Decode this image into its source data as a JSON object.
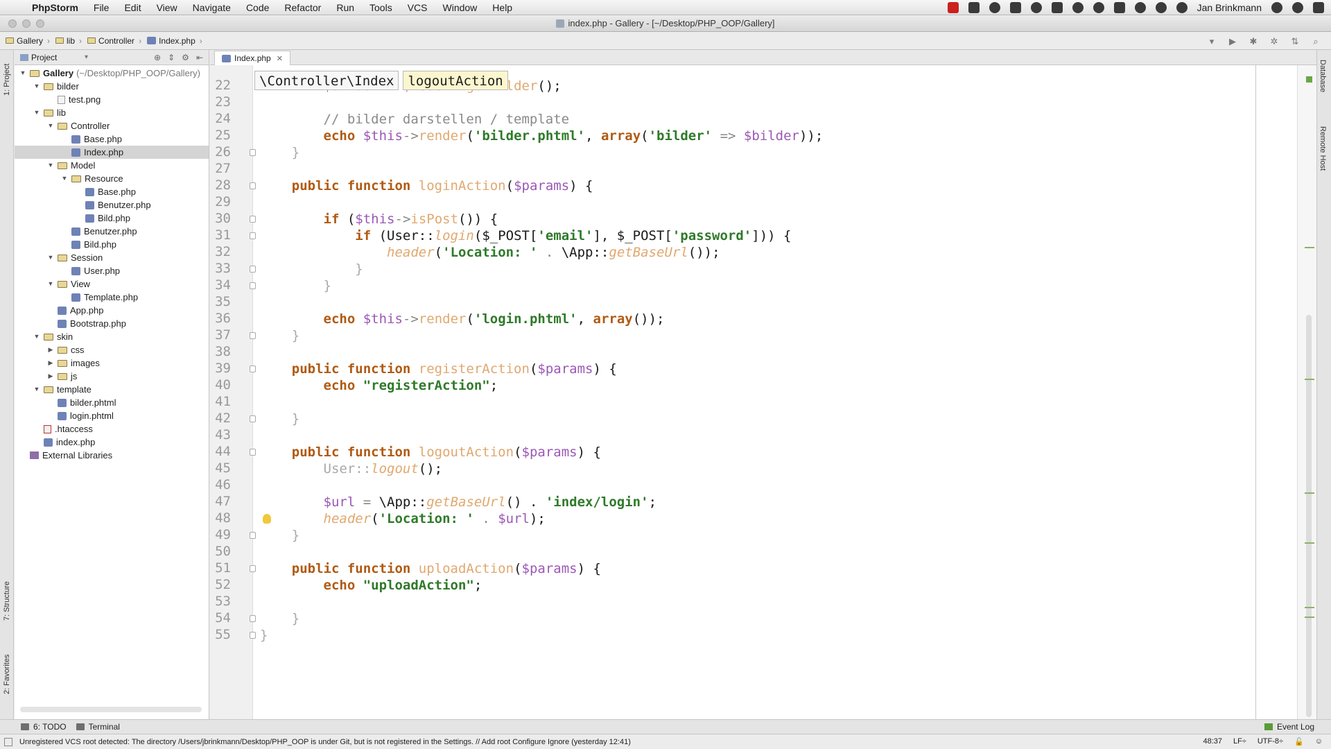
{
  "menubar": {
    "app_name": "PhpStorm",
    "items": [
      "File",
      "Edit",
      "View",
      "Navigate",
      "Code",
      "Refactor",
      "Run",
      "Tools",
      "VCS",
      "Window",
      "Help"
    ],
    "user": "Jan Brinkmann"
  },
  "window": {
    "title": "index.php - Gallery - [~/Desktop/PHP_OOP/Gallery]"
  },
  "navbar": {
    "crumbs": [
      "Gallery",
      "lib",
      "Controller",
      "Index.php"
    ]
  },
  "left_stripe": {
    "project_tab": "1: Project",
    "structure_tab": "7: Structure",
    "favorites_tab": "2: Favorites"
  },
  "project_panel": {
    "selector": "Project",
    "tree": [
      {
        "name": "Gallery",
        "path": "(~/Desktop/PHP_OOP/Gallery)",
        "type": "folder",
        "level": 0,
        "open": true
      },
      {
        "name": "bilder",
        "type": "folder",
        "level": 1,
        "open": true
      },
      {
        "name": "test.png",
        "type": "png",
        "level": 2
      },
      {
        "name": "lib",
        "type": "folder",
        "level": 1,
        "open": true
      },
      {
        "name": "Controller",
        "type": "folder",
        "level": 2,
        "open": true
      },
      {
        "name": "Base.php",
        "type": "php",
        "level": 3
      },
      {
        "name": "Index.php",
        "type": "php",
        "level": 3,
        "selected": true
      },
      {
        "name": "Model",
        "type": "folder",
        "level": 2,
        "open": true
      },
      {
        "name": "Resource",
        "type": "folder",
        "level": 3,
        "open": true
      },
      {
        "name": "Base.php",
        "type": "php",
        "level": 4
      },
      {
        "name": "Benutzer.php",
        "type": "php",
        "level": 4
      },
      {
        "name": "Bild.php",
        "type": "php",
        "level": 4
      },
      {
        "name": "Benutzer.php",
        "type": "php",
        "level": 3
      },
      {
        "name": "Bild.php",
        "type": "php",
        "level": 3
      },
      {
        "name": "Session",
        "type": "folder",
        "level": 2,
        "open": true
      },
      {
        "name": "User.php",
        "type": "php",
        "level": 3
      },
      {
        "name": "View",
        "type": "folder",
        "level": 2,
        "open": true
      },
      {
        "name": "Template.php",
        "type": "php",
        "level": 3
      },
      {
        "name": "App.php",
        "type": "php",
        "level": 2
      },
      {
        "name": "Bootstrap.php",
        "type": "php",
        "level": 2
      },
      {
        "name": "skin",
        "type": "folder",
        "level": 1,
        "open": true
      },
      {
        "name": "css",
        "type": "folder",
        "level": 2,
        "open": false
      },
      {
        "name": "images",
        "type": "folder",
        "level": 2,
        "open": false
      },
      {
        "name": "js",
        "type": "folder",
        "level": 2,
        "open": false
      },
      {
        "name": "template",
        "type": "folder",
        "level": 1,
        "open": true
      },
      {
        "name": "bilder.phtml",
        "type": "phtml",
        "level": 2
      },
      {
        "name": "login.phtml",
        "type": "phtml",
        "level": 2
      },
      {
        "name": ".htaccess",
        "type": "ht",
        "level": 1
      },
      {
        "name": "index.php",
        "type": "php",
        "level": 1
      },
      {
        "name": "External Libraries",
        "type": "lib",
        "level": 0
      }
    ]
  },
  "editor": {
    "tab_label": "Index.php",
    "breadcrumb": [
      "\\Controller\\Index",
      "logoutAction"
    ],
    "lines": [
      {
        "n": 22,
        "segs": [
          [
            "var",
            "        $bilder"
          ],
          [
            "op",
            " = "
          ],
          [
            "var",
            "$model"
          ],
          [
            "op",
            "->"
          ],
          [
            "fn",
            "getBilder"
          ],
          [
            "",
            "();"
          ]
        ]
      },
      {
        "n": 23,
        "segs": []
      },
      {
        "n": 24,
        "segs": [
          [
            "cmt",
            "        // bilder darstellen / template"
          ]
        ]
      },
      {
        "n": 25,
        "segs": [
          [
            "kw",
            "        echo "
          ],
          [
            "var",
            "$this"
          ],
          [
            "op",
            "->"
          ],
          [
            "fn",
            "render"
          ],
          [
            "",
            "("
          ],
          [
            "str",
            "'bilder.phtml'"
          ],
          [
            "",
            ", "
          ],
          [
            "kw",
            "array"
          ],
          [
            "",
            "("
          ],
          [
            "str",
            "'bilder'"
          ],
          [
            "op",
            " => "
          ],
          [
            "var",
            "$bilder"
          ],
          [
            "",
            "));"
          ]
        ]
      },
      {
        "n": 26,
        "segs": [
          [
            "dim",
            "    }"
          ]
        ]
      },
      {
        "n": 27,
        "segs": []
      },
      {
        "n": 28,
        "segs": [
          [
            "kw",
            "    public function "
          ],
          [
            "fn",
            "loginAction"
          ],
          [
            "",
            "("
          ],
          [
            "var",
            "$params"
          ],
          [
            "",
            ") {"
          ]
        ]
      },
      {
        "n": 29,
        "segs": []
      },
      {
        "n": 30,
        "segs": [
          [
            "kw",
            "        if "
          ],
          [
            "",
            "("
          ],
          [
            "var",
            "$this"
          ],
          [
            "op",
            "->"
          ],
          [
            "fn",
            "isPost"
          ],
          [
            "",
            "()) {"
          ]
        ]
      },
      {
        "n": 31,
        "segs": [
          [
            "kw",
            "            if "
          ],
          [
            "",
            "(User::"
          ],
          [
            "fn2",
            "login"
          ],
          [
            "",
            "($_POST["
          ],
          [
            "str",
            "'email'"
          ],
          [
            "",
            "], $_POST["
          ],
          [
            "str",
            "'password'"
          ],
          [
            "",
            "])) {"
          ]
        ]
      },
      {
        "n": 32,
        "segs": [
          [
            "fn2",
            "                header"
          ],
          [
            "",
            "("
          ],
          [
            "str",
            "'Location: '"
          ],
          [
            "op",
            " . "
          ],
          [
            "",
            "\\App::"
          ],
          [
            "fn2",
            "getBaseUrl"
          ],
          [
            "",
            "());"
          ]
        ]
      },
      {
        "n": 33,
        "segs": [
          [
            "dim",
            "            }"
          ]
        ]
      },
      {
        "n": 34,
        "segs": [
          [
            "dim",
            "        }"
          ]
        ]
      },
      {
        "n": 35,
        "segs": []
      },
      {
        "n": 36,
        "segs": [
          [
            "kw",
            "        echo "
          ],
          [
            "var",
            "$this"
          ],
          [
            "op",
            "->"
          ],
          [
            "fn",
            "render"
          ],
          [
            "",
            "("
          ],
          [
            "str",
            "'login.phtml'"
          ],
          [
            "",
            ", "
          ],
          [
            "kw",
            "array"
          ],
          [
            "",
            "());"
          ]
        ]
      },
      {
        "n": 37,
        "segs": [
          [
            "dim",
            "    }"
          ]
        ]
      },
      {
        "n": 38,
        "segs": []
      },
      {
        "n": 39,
        "segs": [
          [
            "kw",
            "    public function "
          ],
          [
            "fn",
            "registerAction"
          ],
          [
            "",
            "("
          ],
          [
            "var",
            "$params"
          ],
          [
            "",
            ") {"
          ]
        ]
      },
      {
        "n": 40,
        "segs": [
          [
            "kw",
            "        echo "
          ],
          [
            "str",
            "\"registerAction\""
          ],
          [
            "",
            ";"
          ]
        ]
      },
      {
        "n": 41,
        "segs": []
      },
      {
        "n": 42,
        "segs": [
          [
            "dim",
            "    }"
          ]
        ]
      },
      {
        "n": 43,
        "segs": []
      },
      {
        "n": 44,
        "segs": [
          [
            "kw",
            "    public function "
          ],
          [
            "fn",
            "logoutAction"
          ],
          [
            "",
            "("
          ],
          [
            "var",
            "$params"
          ],
          [
            "",
            ") {"
          ]
        ]
      },
      {
        "n": 45,
        "segs": [
          [
            "dim",
            "        User::"
          ],
          [
            "fn2",
            "logout"
          ],
          [
            "",
            "();"
          ]
        ]
      },
      {
        "n": 46,
        "segs": []
      },
      {
        "n": 47,
        "segs": [
          [
            "var",
            "        $url"
          ],
          [
            "op",
            " = "
          ],
          [
            "",
            "\\App::"
          ],
          [
            "fn2",
            "getBaseUrl"
          ],
          [
            "",
            "() . "
          ],
          [
            "str",
            "'index/login'"
          ],
          [
            "",
            ";"
          ]
        ]
      },
      {
        "n": 48,
        "segs": [
          [
            "fn2",
            "        header"
          ],
          [
            "",
            "("
          ],
          [
            "str",
            "'Location: '"
          ],
          [
            "op",
            " . "
          ],
          [
            "var",
            "$url"
          ],
          [
            "",
            ");"
          ]
        ]
      },
      {
        "n": 49,
        "segs": [
          [
            "dim",
            "    }"
          ]
        ]
      },
      {
        "n": 50,
        "segs": []
      },
      {
        "n": 51,
        "segs": [
          [
            "kw",
            "    public function "
          ],
          [
            "fn",
            "uploadAction"
          ],
          [
            "",
            "("
          ],
          [
            "var",
            "$params"
          ],
          [
            "",
            ") {"
          ]
        ]
      },
      {
        "n": 52,
        "segs": [
          [
            "kw",
            "        echo "
          ],
          [
            "str",
            "\"uploadAction\""
          ],
          [
            "",
            ";"
          ]
        ]
      },
      {
        "n": 53,
        "segs": []
      },
      {
        "n": 54,
        "segs": [
          [
            "dim",
            "    }"
          ]
        ]
      },
      {
        "n": 55,
        "segs": [
          [
            "dim",
            "}"
          ]
        ]
      }
    ]
  },
  "right_stripe": {
    "database_tab": "Database",
    "remote_host_tab": "Remote Host"
  },
  "bottom_tools": {
    "todo": "6: TODO",
    "terminal": "Terminal",
    "event_log": "Event Log"
  },
  "status": {
    "message": "Unregistered VCS root detected: The directory /Users/jbrinkmann/Desktop/PHP_OOP is under Git, but is not registered in the Settings. // Add root  Configure  Ignore (yesterday 12:41)",
    "position": "48:37",
    "line_sep": "LF÷",
    "encoding": "UTF-8÷"
  },
  "colors": {
    "keyword": "#b05a12",
    "function": "#e0a870",
    "variable": "#9b58b5",
    "string": "#2f7a2a",
    "comment": "#8a8a8a"
  }
}
